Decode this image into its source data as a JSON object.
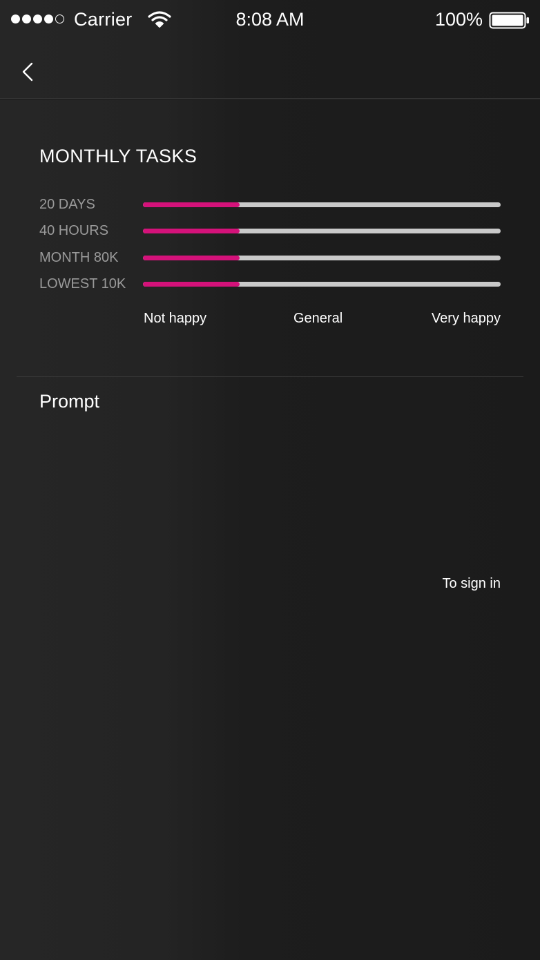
{
  "status_bar": {
    "carrier": "Carrier",
    "time": "8:08 AM",
    "battery": "100%",
    "signal_bars_filled": 4,
    "signal_bars_total": 5
  },
  "nav": {
    "back_icon": "chevron-left-icon"
  },
  "monthly_tasks": {
    "title": "MONTHLY TASKS",
    "rows": [
      {
        "label": "20 DAYS",
        "level": 0.27
      },
      {
        "label": "40 HOURS",
        "level": 0.27
      },
      {
        "label": "MONTH 80K",
        "level": 0.27
      },
      {
        "label": "LOWEST 10K",
        "level": 0.27
      }
    ],
    "scale": {
      "low": "Not happy",
      "mid": "General",
      "high": "Very happy"
    }
  },
  "prompt": {
    "title": "Prompt",
    "sign_in": "To sign in"
  },
  "colors": {
    "accent": "#d4127a",
    "track": "#c9c9c9",
    "label": "#9a9a9a"
  }
}
